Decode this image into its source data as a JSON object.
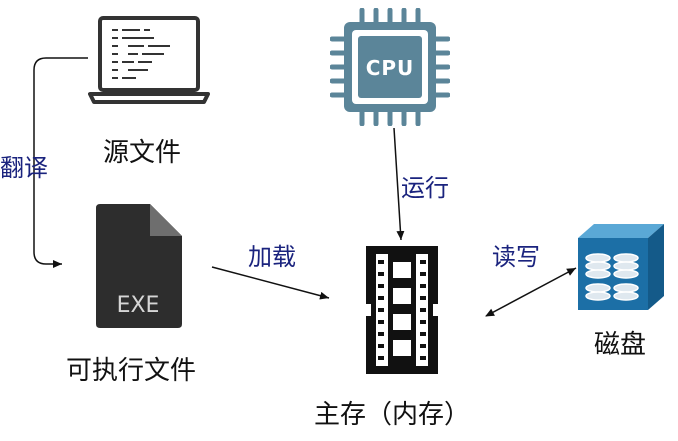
{
  "nodes": {
    "source": {
      "label": "源文件",
      "icon": "laptop-code-icon"
    },
    "exe": {
      "label": "可执行文件",
      "icon": "exe-file-icon",
      "icon_text": "EXE"
    },
    "cpu": {
      "label": "",
      "icon": "cpu-chip-icon",
      "icon_text": "CPU"
    },
    "memory": {
      "label": "主存（内存）",
      "icon": "memory-module-icon"
    },
    "disk": {
      "label": "磁盘",
      "icon": "disk-storage-icon"
    }
  },
  "edges": {
    "compile": {
      "label": "翻译"
    },
    "load": {
      "label": "加载"
    },
    "run": {
      "label": "运行"
    },
    "readwrite": {
      "label": "读写"
    }
  },
  "colors": {
    "edge_label": "#1a237e",
    "node_label": "#111111",
    "cpu": "#5b8599",
    "exe": "#2d2d2d",
    "disk": "#1c6fa6",
    "memory": "#111111"
  }
}
